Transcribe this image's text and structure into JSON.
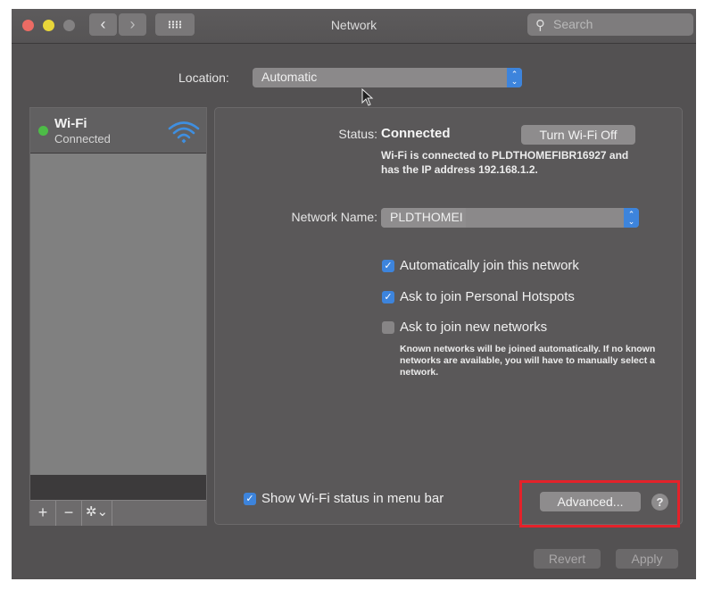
{
  "window": {
    "title": "Network",
    "search_placeholder": "Search",
    "nav": {
      "back": "‹",
      "forward": "›"
    }
  },
  "location": {
    "label": "Location:",
    "value": "Automatic"
  },
  "sidebar": {
    "items": [
      {
        "name": "Wi-Fi",
        "status": "Connected",
        "status_color": "#4dbc47",
        "icon": "wifi-icon"
      }
    ],
    "toolbar": {
      "add": "+",
      "remove": "−",
      "gear": "✲⌄"
    }
  },
  "panel": {
    "status_label": "Status:",
    "status_value": "Connected",
    "turn_off_button": "Turn Wi-Fi Off",
    "status_description": "Wi-Fi is connected to PLDTHOMEFIBR16927 and has the IP address 192.168.1.2.",
    "network_name_label": "Network Name:",
    "network_name_value": "PLDTHOMEI",
    "checkboxes": [
      {
        "label": "Automatically join this network",
        "checked": true
      },
      {
        "label": "Ask to join Personal Hotspots",
        "checked": true
      },
      {
        "label": "Ask to join new networks",
        "checked": false
      }
    ],
    "new_networks_description": "Known networks will be joined automatically. If no known networks are available, you will have to manually select a network.",
    "show_status": {
      "label": "Show Wi-Fi status in menu bar",
      "checked": true
    },
    "advanced_button": "Advanced...",
    "help_button": "?"
  },
  "footer": {
    "revert": "Revert",
    "apply": "Apply"
  },
  "colors": {
    "accent": "#3d84dc",
    "highlight": "#e4222a",
    "connected": "#4dbc47"
  }
}
